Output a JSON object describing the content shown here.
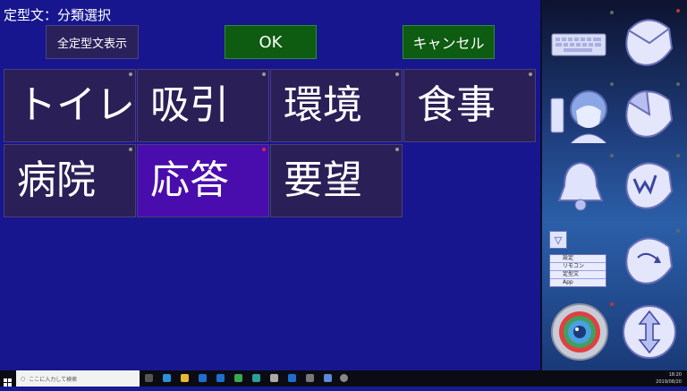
{
  "header": {
    "title": "定型文：分類選択"
  },
  "buttons": {
    "show_all": "全定型文表示",
    "ok": "OK",
    "cancel": "キャンセル"
  },
  "categories": [
    {
      "label": "トイレ"
    },
    {
      "label": "吸引"
    },
    {
      "label": "環境"
    },
    {
      "label": "食事"
    },
    {
      "label": "病院"
    },
    {
      "label": "応答",
      "selected": true
    },
    {
      "label": "要望"
    }
  ],
  "sidebar": {
    "menu": {
      "items": [
        "設定",
        "リモコン",
        "定型文",
        "App"
      ]
    },
    "tiles": [
      "keyboard-icon",
      "mouse-icon",
      "speech-person-icon",
      "mouse-left-click-icon",
      "bell-icon",
      "mouse-wheel-icon",
      "menu-icon",
      "mouse-drag-icon",
      "eye-gaze-icon",
      "scroll-arrows-icon"
    ]
  },
  "taskbar": {
    "search_placeholder": "ここに入力して検索",
    "time": "18:20",
    "date": "2019/08/20"
  },
  "colors": {
    "background": "#17168f",
    "tile": "#2b1f57",
    "selected": "#4a0dad",
    "action_green": "#0e5b12"
  }
}
